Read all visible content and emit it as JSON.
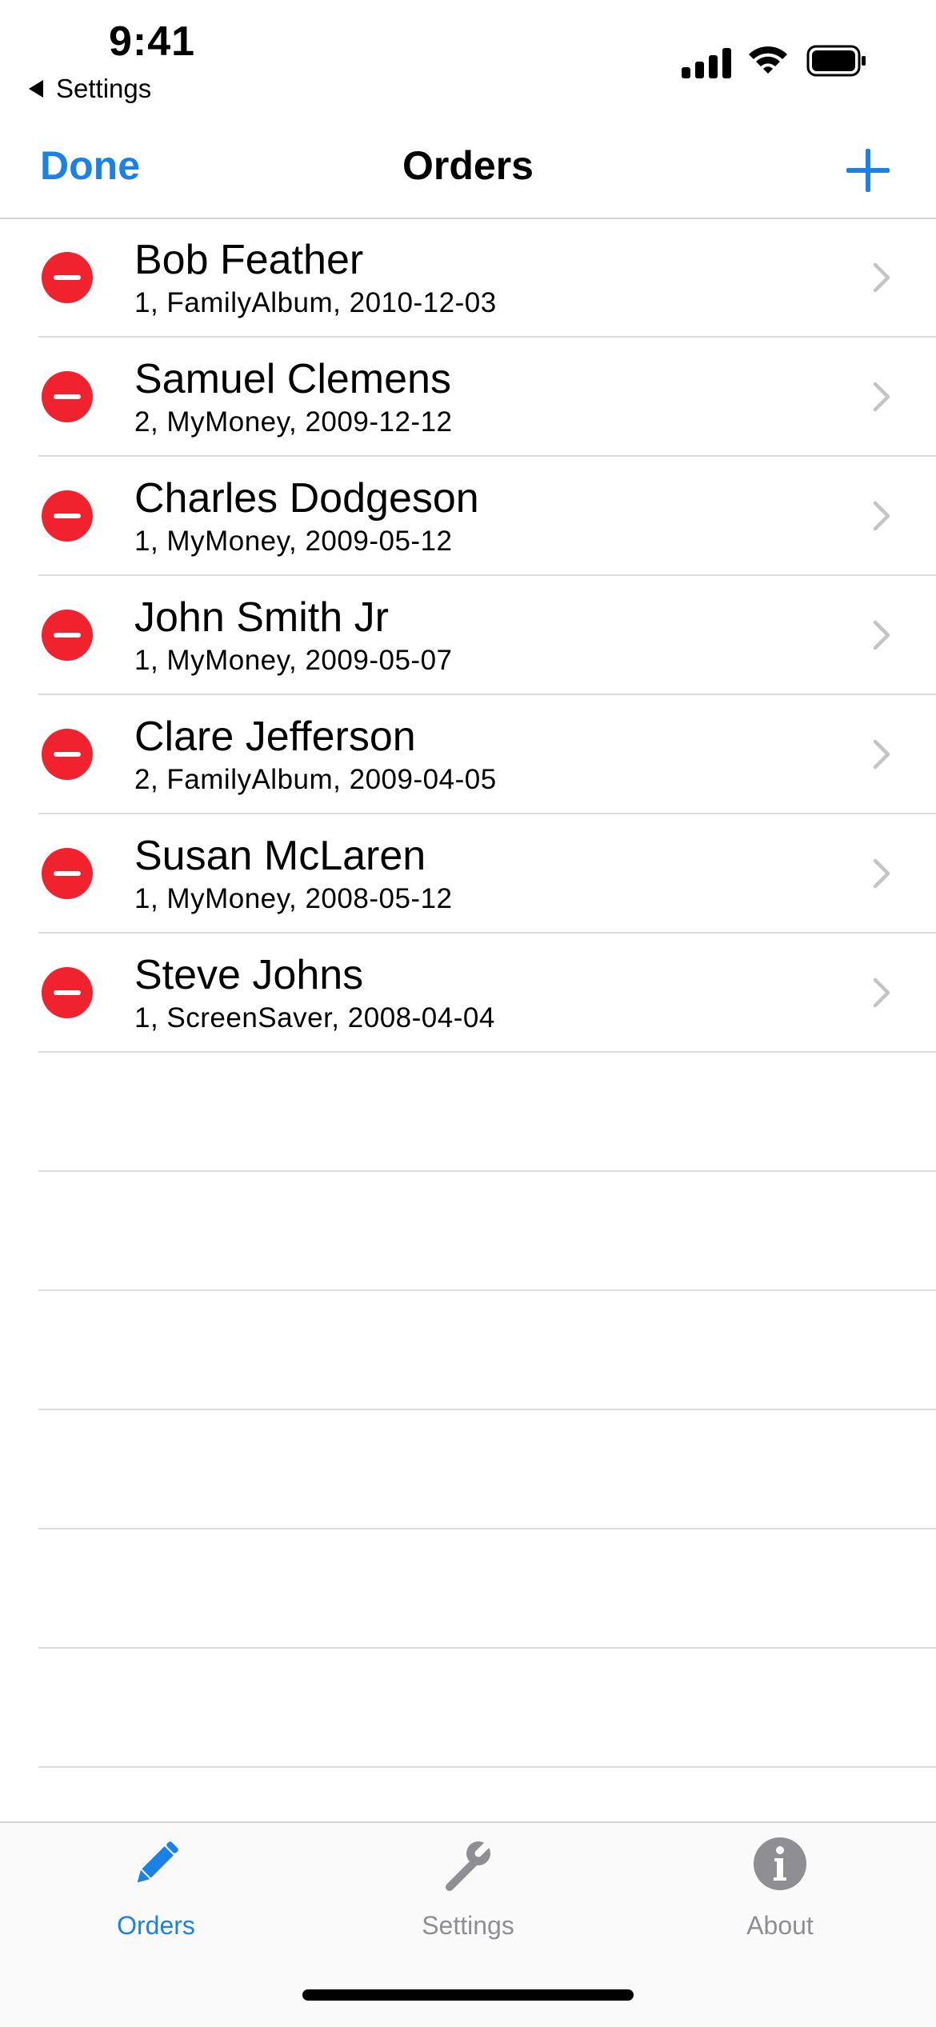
{
  "status_bar": {
    "time": "9:41",
    "back_app": "Settings"
  },
  "nav": {
    "done_label": "Done",
    "title": "Orders",
    "add_icon": "plus-icon"
  },
  "orders": [
    {
      "name": "Bob Feather",
      "detail": "1, FamilyAlbum, 2010-12-03"
    },
    {
      "name": "Samuel Clemens",
      "detail": "2, MyMoney, 2009-12-12"
    },
    {
      "name": "Charles Dodgeson",
      "detail": "1, MyMoney, 2009-05-12"
    },
    {
      "name": "John Smith Jr",
      "detail": "1, MyMoney, 2009-05-07"
    },
    {
      "name": "Clare Jefferson",
      "detail": "2, FamilyAlbum, 2009-04-05"
    },
    {
      "name": "Susan McLaren",
      "detail": "1, MyMoney, 2008-05-12"
    },
    {
      "name": "Steve Johns",
      "detail": "1, ScreenSaver, 2008-04-04"
    }
  ],
  "tabs": [
    {
      "label": "Orders",
      "icon": "pencil-icon",
      "selected": true
    },
    {
      "label": "Settings",
      "icon": "wrench-icon",
      "selected": false
    },
    {
      "label": "About",
      "icon": "info-icon",
      "selected": false
    }
  ],
  "colors": {
    "accent": "#1a82e6",
    "delete": "#f0222d",
    "inactive": "#8e8e93"
  }
}
